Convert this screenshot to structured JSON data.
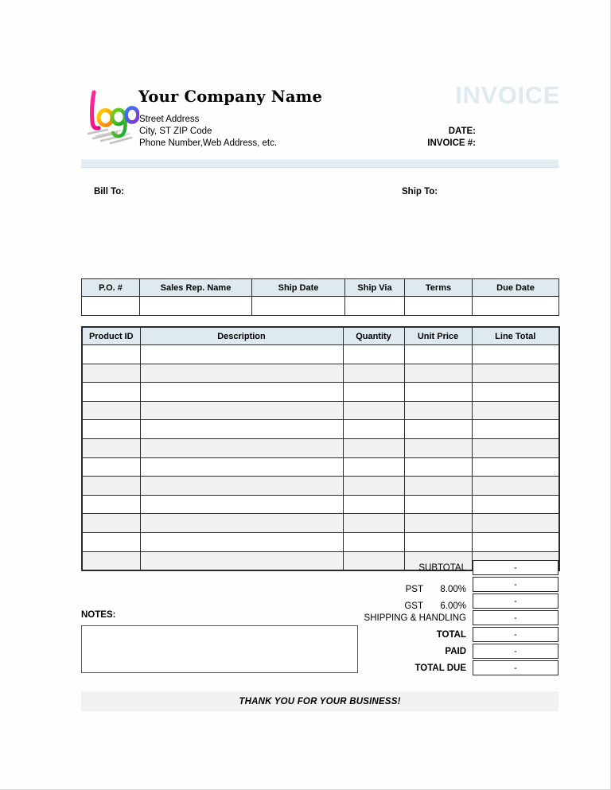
{
  "document": {
    "type": "invoice-template",
    "title_watermark": "INVOICE"
  },
  "company": {
    "logo_alt": "Logo",
    "name": "Your Company Name",
    "address_line1": "Street Address",
    "address_line2": "City, ST  ZIP Code",
    "address_line3": "Phone Number,Web Address, etc."
  },
  "meta": {
    "date_label": "DATE:",
    "invoice_number_label": "INVOICE #:"
  },
  "parties": {
    "bill_to_label": "Bill To:",
    "ship_to_label": "Ship To:"
  },
  "order_info": {
    "headers": [
      "P.O. #",
      "Sales Rep. Name",
      "Ship Date",
      "Ship Via",
      "Terms",
      "Due Date"
    ],
    "values": [
      "",
      "",
      "",
      "",
      "",
      ""
    ]
  },
  "line_items": {
    "headers": [
      "Product ID",
      "Description",
      "Quantity",
      "Unit Price",
      "Line Total"
    ],
    "row_count": 12,
    "rows": [
      [
        "",
        "",
        "",
        "",
        ""
      ],
      [
        "",
        "",
        "",
        "",
        ""
      ],
      [
        "",
        "",
        "",
        "",
        ""
      ],
      [
        "",
        "",
        "",
        "",
        ""
      ],
      [
        "",
        "",
        "",
        "",
        ""
      ],
      [
        "",
        "",
        "",
        "",
        ""
      ],
      [
        "",
        "",
        "",
        "",
        ""
      ],
      [
        "",
        "",
        "",
        "",
        ""
      ],
      [
        "",
        "",
        "",
        "",
        ""
      ],
      [
        "",
        "",
        "",
        "",
        ""
      ],
      [
        "",
        "",
        "",
        "",
        ""
      ],
      [
        "",
        "",
        "",
        "",
        ""
      ]
    ]
  },
  "totals": [
    {
      "label": "SUBTOTAL",
      "rate": "",
      "value": "-",
      "bold": false
    },
    {
      "label": "PST",
      "rate": "8.00%",
      "value": "-",
      "bold": false
    },
    {
      "label": "GST",
      "rate": "6.00%",
      "value": "-",
      "bold": false
    },
    {
      "label": "SHIPPING & HANDLING",
      "rate": "",
      "value": "-",
      "bold": false
    },
    {
      "label": "TOTAL",
      "rate": "",
      "value": "-",
      "bold": true
    },
    {
      "label": "PAID",
      "rate": "",
      "value": "-",
      "bold": true
    },
    {
      "label": "TOTAL DUE",
      "rate": "",
      "value": "-",
      "bold": true
    }
  ],
  "notes": {
    "label": "NOTES:",
    "value": ""
  },
  "footer": {
    "message": "THANK YOU FOR YOUR BUSINESS!"
  },
  "colors": {
    "watermark": "#dfeaf0",
    "header_fill": "#dfeaf0",
    "rule": "#e2ecf1",
    "stripe": "#f1f1f1",
    "footer_band": "#f1f1f1",
    "border": "#2b2b2b"
  }
}
